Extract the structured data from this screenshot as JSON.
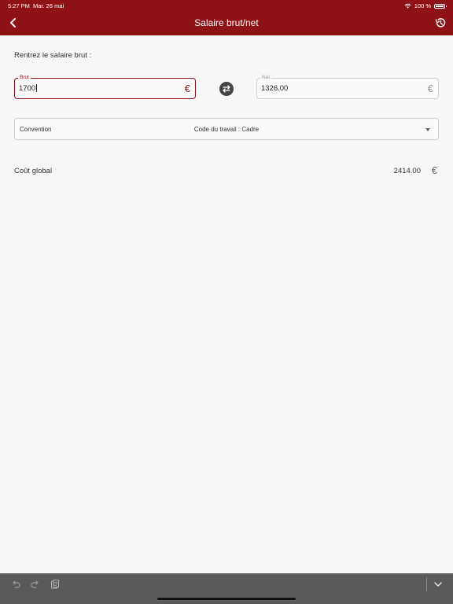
{
  "status_bar": {
    "time": "5:27 PM",
    "date": "Mar. 26 mai",
    "battery": "100 %"
  },
  "header": {
    "title": "Salaire brut/net",
    "back_icon": "chevron-left-icon",
    "history_icon": "history-icon"
  },
  "form": {
    "prompt": "Rentrez le salaire brut :",
    "brut": {
      "label": "Brut",
      "value": "1700",
      "currency": "€"
    },
    "net": {
      "label": "Net",
      "value": "1326.00",
      "currency": "€"
    },
    "swap_icon": "swap-arrows-icon"
  },
  "convention": {
    "label": "Convention",
    "value": "Code du travail : Cadre"
  },
  "result": {
    "label": "Coût global",
    "value": "2414.00",
    "currency": "€"
  },
  "toolbar": {
    "undo_icon": "undo-icon",
    "redo_icon": "redo-icon",
    "paste_icon": "clipboard-icon",
    "hide_keyboard_icon": "chevron-down-icon"
  },
  "colors": {
    "brand": "#8e1116",
    "background": "#f7f7f7",
    "toolbar": "#5a5a5a"
  }
}
